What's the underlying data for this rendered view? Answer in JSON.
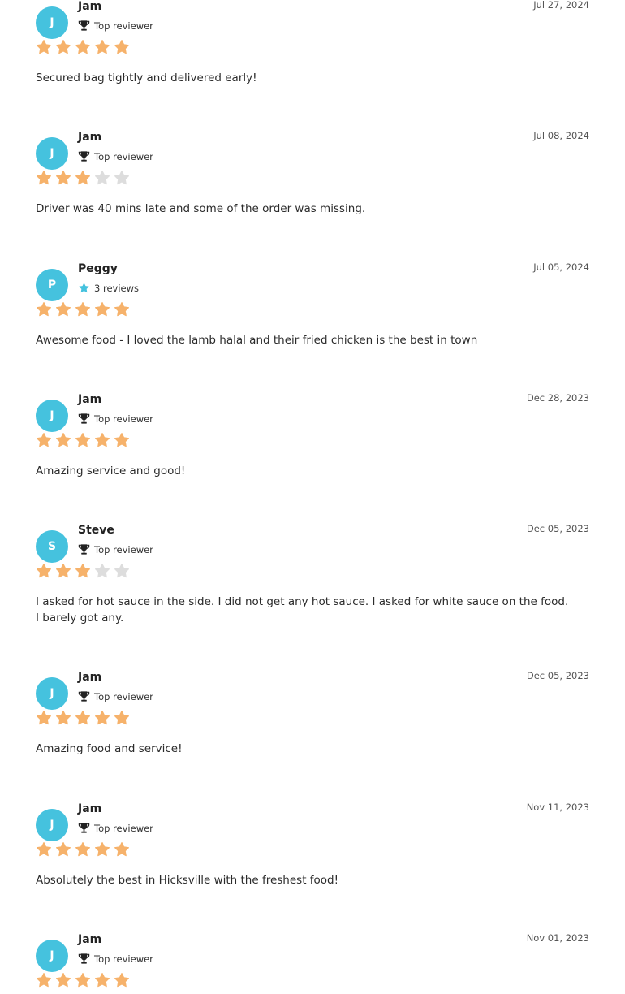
{
  "colors": {
    "avatar_bg": "#45c2de",
    "star_filled": "#f6b26b",
    "star_empty": "#dddddd",
    "badge_star": "#45c2de"
  },
  "reviews": [
    {
      "initial": "J",
      "name": "Jam",
      "badge_icon": "trophy-icon",
      "badge": "Top reviewer",
      "date": "Jul 27, 2024",
      "rating": 5,
      "text": "Secured bag tightly and delivered early!"
    },
    {
      "initial": "J",
      "name": "Jam",
      "badge_icon": "trophy-icon",
      "badge": "Top reviewer",
      "date": "Jul 08, 2024",
      "rating": 3,
      "text": "Driver was 40 mins late and some of the order was missing."
    },
    {
      "initial": "P",
      "name": "Peggy",
      "badge_icon": "star-icon",
      "badge": "3 reviews",
      "date": "Jul 05, 2024",
      "rating": 5,
      "text": "Awesome food - I loved the lamb halal and their fried chicken is the best in town"
    },
    {
      "initial": "J",
      "name": "Jam",
      "badge_icon": "trophy-icon",
      "badge": "Top reviewer",
      "date": "Dec 28, 2023",
      "rating": 5,
      "text": "Amazing service and good!"
    },
    {
      "initial": "S",
      "name": "Steve",
      "badge_icon": "trophy-icon",
      "badge": "Top reviewer",
      "date": "Dec 05, 2023",
      "rating": 3,
      "text": "I asked for hot sauce in the side. I did not get any hot sauce. I asked for white sauce on the food. I barely got any."
    },
    {
      "initial": "J",
      "name": "Jam",
      "badge_icon": "trophy-icon",
      "badge": "Top reviewer",
      "date": "Dec 05, 2023",
      "rating": 5,
      "text": "Amazing food and service!"
    },
    {
      "initial": "J",
      "name": "Jam",
      "badge_icon": "trophy-icon",
      "badge": "Top reviewer",
      "date": "Nov 11, 2023",
      "rating": 5,
      "text": "Absolutely the best in Hicksville with the freshest food!"
    },
    {
      "initial": "J",
      "name": "Jam",
      "badge_icon": "trophy-icon",
      "badge": "Top reviewer",
      "date": "Nov 01, 2023",
      "rating": 5,
      "text": ""
    }
  ]
}
